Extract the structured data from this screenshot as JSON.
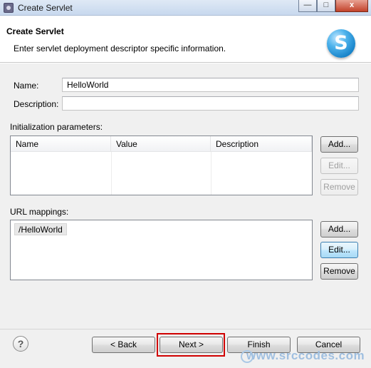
{
  "window": {
    "title": "Create Servlet",
    "minimize_glyph": "—",
    "maximize_glyph": "□",
    "close_glyph": "x",
    "accent_close": "#c2422a"
  },
  "header": {
    "title": "Create Servlet",
    "description": "Enter servlet deployment descriptor specific information.",
    "logo_letter": "S"
  },
  "form": {
    "name_label": "Name:",
    "name_value": "HelloWorld",
    "description_label": "Description:",
    "description_value": ""
  },
  "init_params": {
    "label": "Initialization parameters:",
    "columns": [
      "Name",
      "Value",
      "Description"
    ],
    "rows": [],
    "add_label": "Add...",
    "edit_label": "Edit...",
    "remove_label": "Remove"
  },
  "url_mappings": {
    "label": "URL mappings:",
    "items": [
      "/HelloWorld"
    ],
    "add_label": "Add...",
    "edit_label": "Edit...",
    "remove_label": "Remove"
  },
  "footer": {
    "help_glyph": "?",
    "back_label": "< Back",
    "next_label": "Next >",
    "finish_label": "Finish",
    "cancel_label": "Cancel",
    "highlight_color": "#d00000"
  },
  "watermark": {
    "text": "www.srccodes.com"
  }
}
